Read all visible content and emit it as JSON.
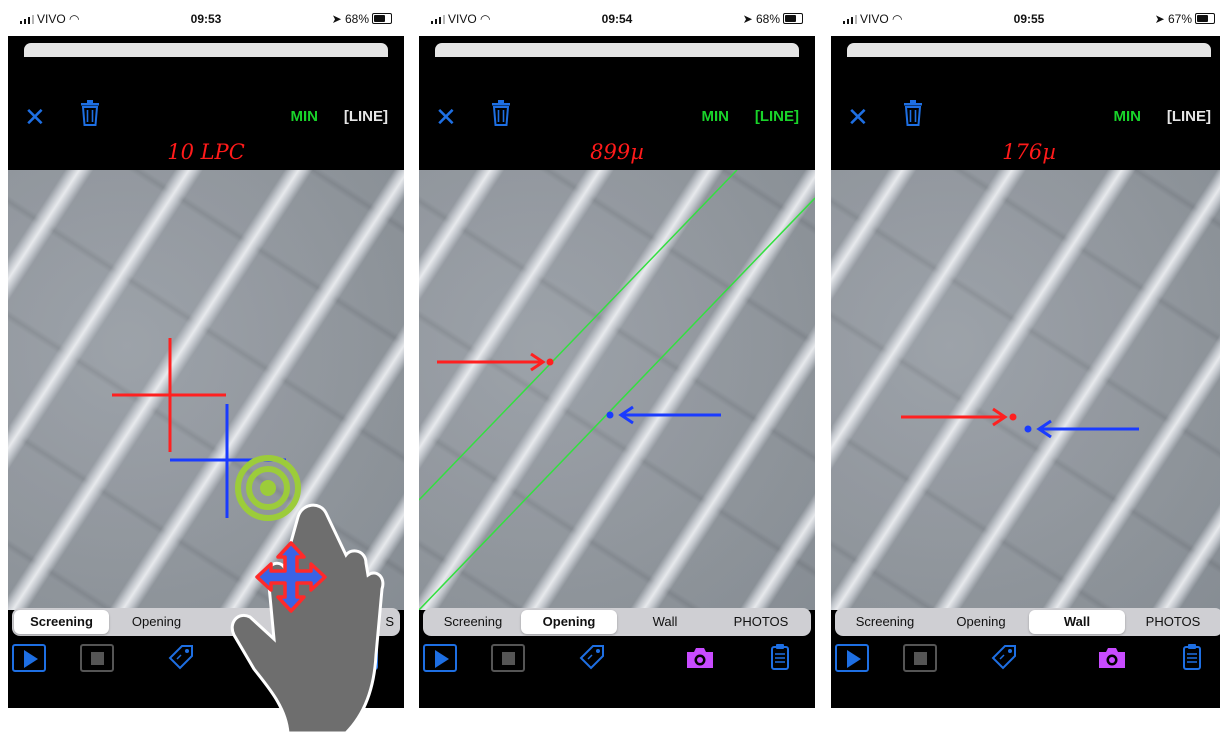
{
  "colors": {
    "accent_blue": "#1e6fe3",
    "active_green": "#19d42a",
    "reading_red": "#ff1a1a",
    "camera_magenta": "#c84bff",
    "segment_bg": "#cfcfd3"
  },
  "screens": [
    {
      "status": {
        "carrier": "VIVO",
        "time": "09:53",
        "battery": "68%"
      },
      "header": {
        "close_icon": "close-icon",
        "trash_icon": "trash-icon",
        "min_label": "MIN",
        "line_label": "[LINE]",
        "line_active": false
      },
      "reading": "10 LPC",
      "tabs": [
        "Screening",
        "Opening",
        "",
        "S"
      ],
      "active_tab": 0,
      "overlay": "crosshairs-and-touch-gesture"
    },
    {
      "status": {
        "carrier": "VIVO",
        "time": "09:54",
        "battery": "68%"
      },
      "header": {
        "close_icon": "close-icon",
        "trash_icon": "trash-icon",
        "min_label": "MIN",
        "line_label": "[LINE]",
        "line_active": true
      },
      "reading": "899µ",
      "tabs": [
        "Screening",
        "Opening",
        "Wall",
        "PHOTOS"
      ],
      "active_tab": 1,
      "overlay": "two-lines-with-arrows"
    },
    {
      "status": {
        "carrier": "VIVO",
        "time": "09:55",
        "battery": "67%"
      },
      "header": {
        "close_icon": "close-icon",
        "trash_icon": "trash-icon",
        "min_label": "MIN",
        "line_label": "[LINE]",
        "line_active": false
      },
      "reading": "176µ",
      "tabs": [
        "Screening",
        "Opening",
        "Wall",
        "PHOTOS"
      ],
      "active_tab": 2,
      "overlay": "two-points-with-arrows"
    }
  ]
}
